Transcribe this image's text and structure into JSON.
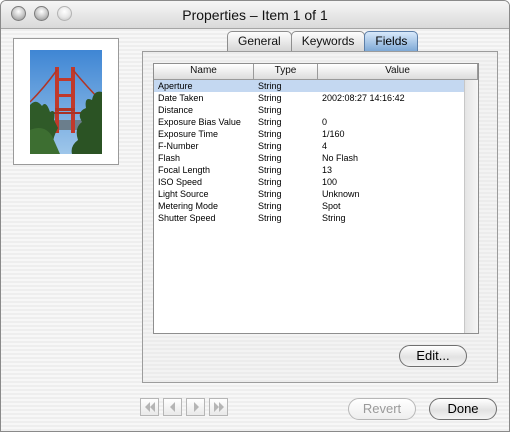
{
  "window": {
    "title": "Properties – Item 1 of 1"
  },
  "tabs": [
    {
      "label": "General",
      "active": false
    },
    {
      "label": "Keywords",
      "active": false
    },
    {
      "label": "Fields",
      "active": true
    }
  ],
  "table": {
    "columns": [
      "Name",
      "Type",
      "Value"
    ],
    "rows": [
      {
        "name": "Aperture",
        "type": "String",
        "value": ""
      },
      {
        "name": "Date Taken",
        "type": "String",
        "value": "2002:08:27 14:16:42"
      },
      {
        "name": "Distance",
        "type": "String",
        "value": ""
      },
      {
        "name": "Exposure Bias Value",
        "type": "String",
        "value": "0"
      },
      {
        "name": "Exposure Time",
        "type": "String",
        "value": "1/160"
      },
      {
        "name": "F-Number",
        "type": "String",
        "value": "4"
      },
      {
        "name": "Flash",
        "type": "String",
        "value": "No Flash"
      },
      {
        "name": "Focal Length",
        "type": "String",
        "value": "13"
      },
      {
        "name": "ISO Speed",
        "type": "String",
        "value": "100"
      },
      {
        "name": "Light Source",
        "type": "String",
        "value": "Unknown"
      },
      {
        "name": "Metering Mode",
        "type": "String",
        "value": "Spot"
      },
      {
        "name": "Shutter Speed",
        "type": "String",
        "value": "String"
      }
    ],
    "selected_row": "Aperture"
  },
  "buttons": {
    "edit": "Edit...",
    "revert": "Revert",
    "done": "Done"
  },
  "nav_icons": [
    "first-icon",
    "previous-icon",
    "next-icon",
    "last-icon"
  ],
  "colors": {
    "tab_active": "#7fa9d6",
    "selection": "#c4d8f1"
  }
}
